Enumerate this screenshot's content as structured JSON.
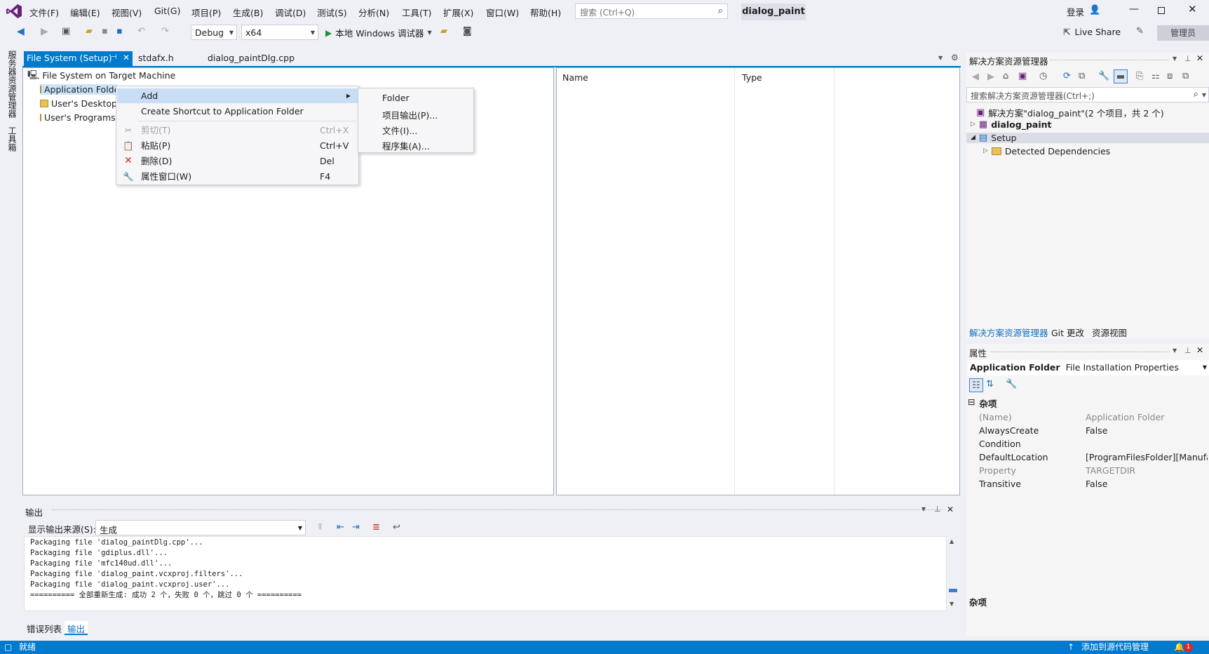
{
  "menu": {
    "items": [
      "文件(F)",
      "编辑(E)",
      "视图(V)",
      "Git(G)",
      "项目(P)",
      "生成(B)",
      "调试(D)",
      "测试(S)",
      "分析(N)",
      "工具(T)",
      "扩展(X)",
      "窗口(W)",
      "帮助(H)"
    ],
    "search_placeholder": "搜索 (Ctrl+Q)",
    "solution_name": "dialog_paint",
    "login": "登录",
    "live_share": "Live Share",
    "admin_badge": "管理员"
  },
  "toolbar": {
    "config": "Debug",
    "platform": "x64",
    "run_label": "本地 Windows 调试器"
  },
  "left_strip": {
    "server_explorer": "服务器资源管理器",
    "toolbox": "工具箱"
  },
  "doc_tabs": [
    {
      "label": "File System (Setup)"
    },
    {
      "label": "stdafx.h"
    },
    {
      "label": "dialog_paintDlg.cpp"
    }
  ],
  "file_system": {
    "root": "File System on Target Machine",
    "items": [
      "Application Folder",
      "User's Desktop",
      "User's Programs Menu"
    ],
    "col_name": "Name",
    "col_type": "Type"
  },
  "context_menu": {
    "add": "Add",
    "create_shortcut": "Create Shortcut to Application Folder",
    "cut": "剪切(T)",
    "cut_sc": "Ctrl+X",
    "paste": "粘贴(P)",
    "paste_sc": "Ctrl+V",
    "delete": "删除(D)",
    "delete_sc": "Del",
    "properties": "属性窗口(W)",
    "properties_sc": "F4"
  },
  "submenu": [
    "Folder",
    "项目输出(P)...",
    "文件(I)...",
    "程序集(A)..."
  ],
  "output": {
    "title": "输出",
    "source_label": "显示输出来源(S):",
    "source_value": "生成",
    "lines": [
      "Packaging file 'dialog_paintDlg.cpp'...",
      "Packaging file 'gdiplus.dll'...",
      "Packaging file 'mfc140ud.dll'...",
      "Packaging file 'dialog_paint.vcxproj.filters'...",
      "Packaging file 'dialog_paint.vcxproj.user'...",
      "========== 全部重新生成: 成功 2 个，失败 0 个，跳过 0 个 =========="
    ]
  },
  "bottom_tabs": [
    "错误列表",
    "输出"
  ],
  "solution_explorer": {
    "title": "解决方案资源管理器",
    "search_placeholder": "搜索解决方案资源管理器(Ctrl+;)",
    "solution": "解决方案\"dialog_paint\"(2 个项目，共 2 个)",
    "project1": "dialog_paint",
    "project2": "Setup",
    "deps": "Detected Dependencies",
    "tabs": [
      "解决方案资源管理器",
      "Git 更改",
      "资源视图"
    ]
  },
  "properties": {
    "title": "属性",
    "object": "Application Folder",
    "object_type": "File Installation Properties",
    "category": "杂项",
    "rows": [
      {
        "k": "(Name)",
        "v": "Application Folder",
        "gray": true
      },
      {
        "k": "AlwaysCreate",
        "v": "False",
        "gray": false
      },
      {
        "k": "Condition",
        "v": "",
        "gray": false
      },
      {
        "k": "DefaultLocation",
        "v": "[ProgramFilesFolder][Manufac",
        "gray": false
      },
      {
        "k": "Property",
        "v": "TARGETDIR",
        "gray": true
      },
      {
        "k": "Transitive",
        "v": "False",
        "gray": false
      }
    ],
    "desc_title": "杂项"
  },
  "status": {
    "ready": "就绪",
    "source_control": "添加到源代码管理",
    "notifications": "1"
  },
  "colors": {
    "accent": "#007acc",
    "highlight": "#c9def5"
  }
}
